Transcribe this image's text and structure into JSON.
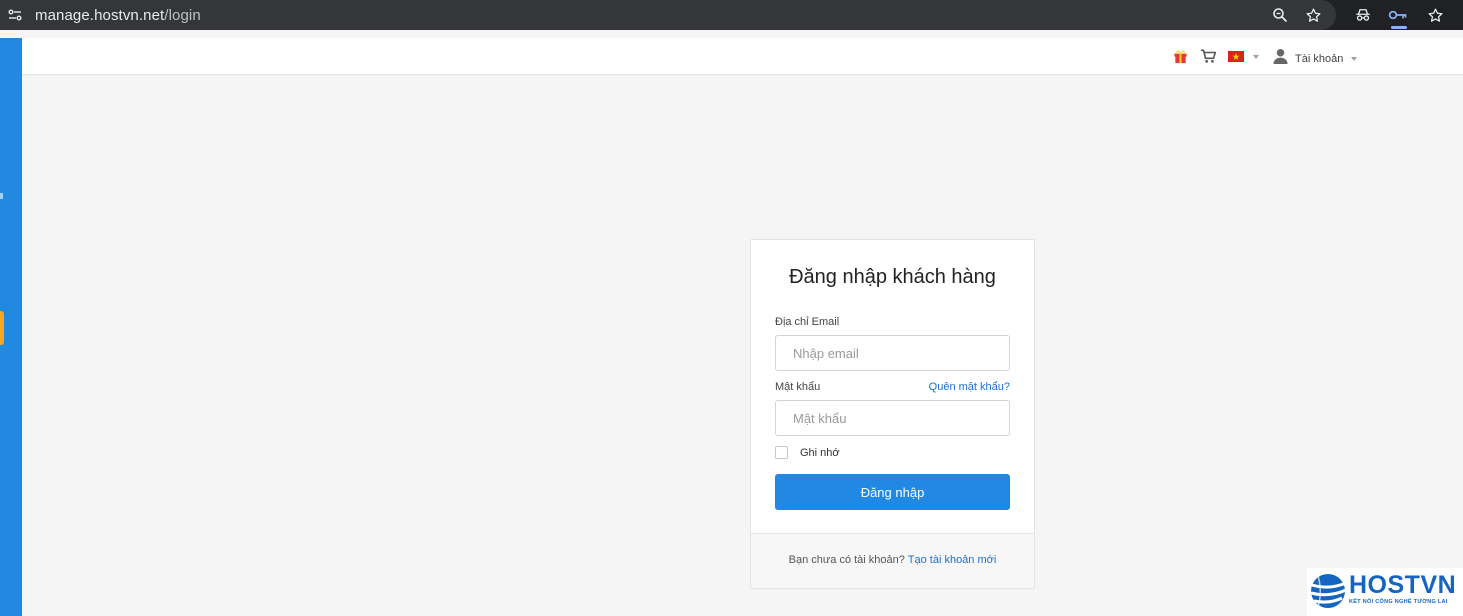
{
  "browser": {
    "url_host": "manage.hostvn.net",
    "url_path": "/login"
  },
  "topnav": {
    "account_label": "Tài khoản"
  },
  "login": {
    "title": "Đăng nhập khách hàng",
    "email_label": "Địa chỉ Email",
    "email_placeholder": "Nhập email",
    "email_value": "",
    "password_label": "Mật khẩu",
    "forgot_link": "Quên mật khẩu?",
    "password_placeholder": "Mật khẩu",
    "password_value": "",
    "remember_label": "Ghi nhớ",
    "remember_checked": false,
    "submit_label": "Đăng nhập",
    "footer_text": "Bạn chưa có tài khoản?",
    "signup_link": "Tạo tài khoản mới"
  },
  "logo": {
    "name": "HOSTVN",
    "tagline": "KẾT NỐI CÔNG NGHỆ TƯƠNG LAI"
  },
  "colors": {
    "accent": "#2189e3",
    "sidebar": "#2289e0",
    "link": "#1d6fcf",
    "browser_bar": "#202124"
  },
  "icons": [
    "site-settings-icon",
    "zoom-icon",
    "bookmark-star-icon",
    "incognito-icon",
    "password-key-icon",
    "extensions-star-icon",
    "gift-icon",
    "cart-icon",
    "vietnam-flag-icon",
    "user-icon"
  ]
}
